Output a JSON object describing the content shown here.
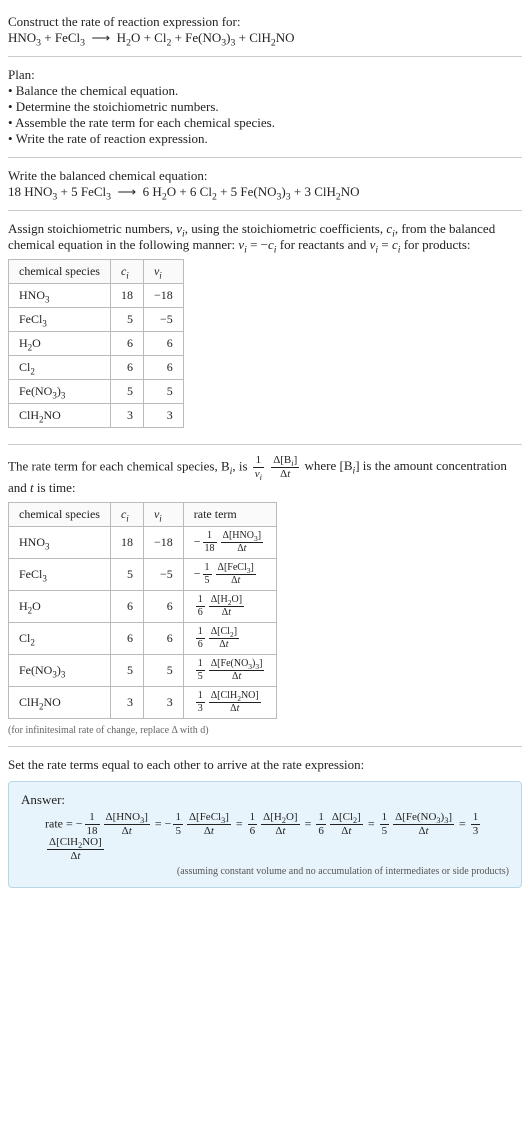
{
  "header": {
    "title": "Construct the rate of reaction expression for:",
    "equation_html": "HNO<sub>3</sub> + FeCl<sub>3</sub> &nbsp;⟶&nbsp; H<sub>2</sub>O + Cl<sub>2</sub> + Fe(NO<sub>3</sub>)<sub>3</sub> + ClH<sub>2</sub>NO"
  },
  "plan": {
    "title": "Plan:",
    "items": [
      "Balance the chemical equation.",
      "Determine the stoichiometric numbers.",
      "Assemble the rate term for each chemical species.",
      "Write the rate of reaction expression."
    ]
  },
  "balanced": {
    "title": "Write the balanced chemical equation:",
    "equation_html": "18 HNO<sub>3</sub> + 5 FeCl<sub>3</sub> &nbsp;⟶&nbsp; 6 H<sub>2</sub>O + 6 Cl<sub>2</sub> + 5 Fe(NO<sub>3</sub>)<sub>3</sub> + 3 ClH<sub>2</sub>NO"
  },
  "stoich": {
    "intro_html": "Assign stoichiometric numbers, <i>ν<sub>i</sub></i>, using the stoichiometric coefficients, <i>c<sub>i</sub></i>, from the balanced chemical equation in the following manner: <i>ν<sub>i</sub></i> = −<i>c<sub>i</sub></i> for reactants and <i>ν<sub>i</sub></i> = <i>c<sub>i</sub></i> for products:",
    "headers": {
      "species": "chemical species",
      "ci": "cᵢ",
      "vi": "νᵢ"
    },
    "rows": [
      {
        "species_html": "HNO<sub>3</sub>",
        "ci": "18",
        "vi": "−18"
      },
      {
        "species_html": "FeCl<sub>3</sub>",
        "ci": "5",
        "vi": "−5"
      },
      {
        "species_html": "H<sub>2</sub>O",
        "ci": "6",
        "vi": "6"
      },
      {
        "species_html": "Cl<sub>2</sub>",
        "ci": "6",
        "vi": "6"
      },
      {
        "species_html": "Fe(NO<sub>3</sub>)<sub>3</sub>",
        "ci": "5",
        "vi": "5"
      },
      {
        "species_html": "ClH<sub>2</sub>NO",
        "ci": "3",
        "vi": "3"
      }
    ]
  },
  "rateterm": {
    "intro_pre": "The rate term for each chemical species, B",
    "intro_mid": ", is ",
    "intro_post_html": " where [B<sub><i>i</i></sub>] is the amount concentration and <i>t</i> is time:",
    "headers": {
      "species": "chemical species",
      "ci": "cᵢ",
      "vi": "νᵢ",
      "rate": "rate term"
    },
    "rows": [
      {
        "species_html": "HNO<sub>3</sub>",
        "ci": "18",
        "vi": "−18",
        "sign": "−",
        "coef_num": "1",
        "coef_den": "18",
        "delta_html": "Δ[HNO<sub>3</sub>]"
      },
      {
        "species_html": "FeCl<sub>3</sub>",
        "ci": "5",
        "vi": "−5",
        "sign": "−",
        "coef_num": "1",
        "coef_den": "5",
        "delta_html": "Δ[FeCl<sub>3</sub>]"
      },
      {
        "species_html": "H<sub>2</sub>O",
        "ci": "6",
        "vi": "6",
        "sign": "",
        "coef_num": "1",
        "coef_den": "6",
        "delta_html": "Δ[H<sub>2</sub>O]"
      },
      {
        "species_html": "Cl<sub>2</sub>",
        "ci": "6",
        "vi": "6",
        "sign": "",
        "coef_num": "1",
        "coef_den": "6",
        "delta_html": "Δ[Cl<sub>2</sub>]"
      },
      {
        "species_html": "Fe(NO<sub>3</sub>)<sub>3</sub>",
        "ci": "5",
        "vi": "5",
        "sign": "",
        "coef_num": "1",
        "coef_den": "5",
        "delta_html": "Δ[Fe(NO<sub>3</sub>)<sub>3</sub>]"
      },
      {
        "species_html": "ClH<sub>2</sub>NO",
        "ci": "3",
        "vi": "3",
        "sign": "",
        "coef_num": "1",
        "coef_den": "3",
        "delta_html": "Δ[ClH<sub>2</sub>NO]"
      }
    ],
    "note": "(for infinitesimal rate of change, replace Δ with d)"
  },
  "final": {
    "title": "Set the rate terms equal to each other to arrive at the rate expression:",
    "answer_label": "Answer:",
    "rate_prefix": "rate = ",
    "terms": [
      {
        "sign": "−",
        "coef_num": "1",
        "coef_den": "18",
        "delta_html": "Δ[HNO<sub>3</sub>]"
      },
      {
        "sign": "−",
        "coef_num": "1",
        "coef_den": "5",
        "delta_html": "Δ[FeCl<sub>3</sub>]"
      },
      {
        "sign": "",
        "coef_num": "1",
        "coef_den": "6",
        "delta_html": "Δ[H<sub>2</sub>O]"
      },
      {
        "sign": "",
        "coef_num": "1",
        "coef_den": "6",
        "delta_html": "Δ[Cl<sub>2</sub>]"
      },
      {
        "sign": "",
        "coef_num": "1",
        "coef_den": "5",
        "delta_html": "Δ[Fe(NO<sub>3</sub>)<sub>3</sub>]"
      },
      {
        "sign": "",
        "coef_num": "1",
        "coef_den": "3",
        "delta_html": "Δ[ClH<sub>2</sub>NO]"
      }
    ],
    "assumption": "(assuming constant volume and no accumulation of intermediates or side products)"
  }
}
